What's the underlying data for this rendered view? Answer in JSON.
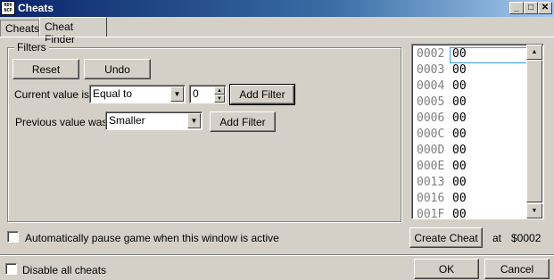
{
  "window": {
    "title": "Cheats",
    "icon_text": "RDV NCP"
  },
  "title_buttons": {
    "minimize": "_",
    "maximize": "□",
    "close": "✕"
  },
  "tabs": [
    {
      "label": "Cheats"
    },
    {
      "label": "Cheat Finder"
    }
  ],
  "filters": {
    "legend": "Filters",
    "reset_label": "Reset",
    "undo_label": "Undo",
    "current_label": "Current value is",
    "current_op": "Equal to",
    "current_value": "0",
    "add_filter_1": "Add Filter",
    "previous_label": "Previous value was",
    "previous_op": "Smaller",
    "add_filter_2": "Add Filter"
  },
  "memory_list": {
    "rows": [
      {
        "addr": "0002",
        "value": "00"
      },
      {
        "addr": "0003",
        "value": "00"
      },
      {
        "addr": "0004",
        "value": "00"
      },
      {
        "addr": "0005",
        "value": "00"
      },
      {
        "addr": "0006",
        "value": "00"
      },
      {
        "addr": "000C",
        "value": "00"
      },
      {
        "addr": "000D",
        "value": "00"
      },
      {
        "addr": "000E",
        "value": "00"
      },
      {
        "addr": "0013",
        "value": "00"
      },
      {
        "addr": "0016",
        "value": "00"
      },
      {
        "addr": "001F",
        "value": "00"
      }
    ]
  },
  "auto_pause_label": "Automatically pause game when this window is active",
  "create_cheat_label": "Create Cheat",
  "at_label": "at",
  "address_value": "$0002",
  "disable_all_label": "Disable all cheats",
  "ok_label": "OK",
  "cancel_label": "Cancel"
}
